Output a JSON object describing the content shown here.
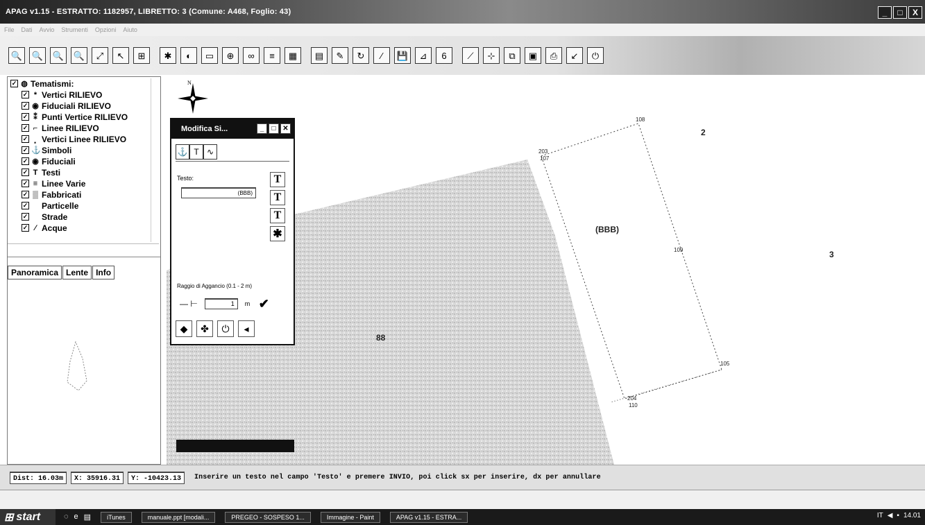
{
  "window": {
    "title": "APAG v1.15 - ESTRATTO: 1182957, LIBRETTO: 3 (Comune: A468, Foglio: 43)",
    "buttons": [
      "_",
      "□",
      "X"
    ]
  },
  "menubar": {
    "items": [
      "File",
      "Dati",
      "Avvio",
      "Strumenti",
      "Opzioni",
      "Aiuto"
    ]
  },
  "toolbar": {
    "icons": [
      "zoom-in-icon",
      "zoom-out-icon",
      "zoom-window-icon",
      "zoom-previous-icon",
      "zoom-extents-icon",
      "select-icon",
      "grid-icon",
      "snap-icon",
      "circle-icon",
      "page-icon",
      "layers-icon",
      "link-icon",
      "list-icon",
      "table-icon",
      "sheet-icon",
      "edit-icon",
      "rotate-icon",
      "line-icon",
      "save-icon",
      "measure-icon",
      "number-icon",
      "polyline-icon",
      "vertex-icon",
      "copy-icon",
      "calculator-icon",
      "print-icon",
      "export-icon",
      "power-icon"
    ],
    "glyphs": [
      "🔍",
      "🔍",
      "🔍",
      "🔍",
      "⤢",
      "↖",
      "⊞",
      "✱",
      "◐",
      "▭",
      "⊕",
      "∞",
      "≡",
      "▦",
      "▤",
      "✎",
      "↻",
      "∕",
      "💾",
      "⊿",
      "6",
      "⟋",
      "⊹",
      "⧉",
      "▣",
      "⎙",
      "↙",
      "⏻"
    ]
  },
  "layers": {
    "header": "Tematismi:",
    "items": [
      {
        "label": "Vertici RILIEVO",
        "icon": "*"
      },
      {
        "label": "Fiduciali RILIEVO",
        "icon": "◉"
      },
      {
        "label": "Punti Vertice RILIEVO",
        "icon": "⁑"
      },
      {
        "label": "Linee RILIEVO",
        "icon": "⌐"
      },
      {
        "label": "Vertici Linee RILIEVO",
        "icon": "⸼"
      },
      {
        "label": "Simboli",
        "icon": "⚓"
      },
      {
        "label": "Fiduciali",
        "icon": "◉"
      },
      {
        "label": "Testi",
        "icon": "T"
      },
      {
        "label": "Linee Varie",
        "icon": "≡"
      },
      {
        "label": "Fabbricati",
        "icon": "▒"
      },
      {
        "label": "Particelle",
        "icon": ""
      },
      {
        "label": "Strade",
        "icon": ""
      },
      {
        "label": "Acque",
        "icon": "∕"
      }
    ]
  },
  "bottom_tabs": [
    "Panoramica",
    "Lente",
    "Info"
  ],
  "map": {
    "labels": [
      {
        "text": "108"
      },
      {
        "text": "2"
      },
      {
        "text": "203"
      },
      {
        "text": "107"
      },
      {
        "text": "(BBB)"
      },
      {
        "text": "109"
      },
      {
        "text": "3"
      },
      {
        "text": "88"
      },
      {
        "text": "105"
      },
      {
        "text": "204"
      },
      {
        "text": "110"
      }
    ]
  },
  "dialog": {
    "title": "Modifica Si...",
    "tabs": [
      "⚓",
      "T",
      "∿"
    ],
    "testo_label": "Testo:",
    "testo_value": "(BBB)",
    "raggio_label": "Raggio di Aggancio (0.1 - 2 m)",
    "raggio_value": "1",
    "raggio_unit": "m",
    "ok_symbol": "✔",
    "side_buttons": [
      "T",
      "T",
      "T",
      "✱"
    ],
    "bottom_buttons": [
      "◆",
      "✤",
      "⏻",
      "◂"
    ]
  },
  "statusbar": {
    "dist": "Dist: 16.03m",
    "x": "X: 35916.31",
    "y": "Y: -10423.13",
    "message": "Inserire un testo nel campo 'Testo' e premere INVIO, poi click sx per inserire, dx per annullare"
  },
  "taskbar": {
    "start": "start",
    "tasks": [
      "iTunes",
      "manuale.ppt [modali...",
      "PREGEO - SOSPESO 1...",
      "Immagine - Paint",
      "APAG v1.15 - ESTRA..."
    ],
    "tray_text": "IT",
    "clock": "14.01"
  }
}
